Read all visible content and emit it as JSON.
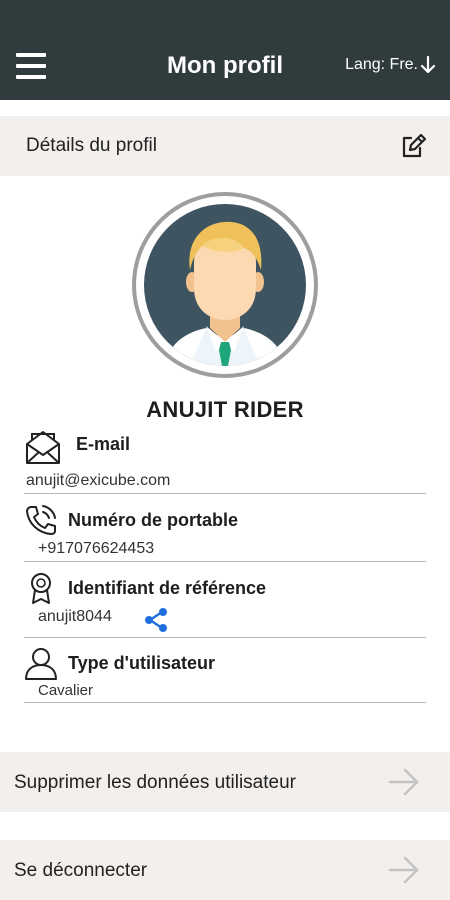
{
  "header": {
    "title": "Mon profil",
    "lang_label": "Lang: Fre.",
    "menu_icon": "hamburger-menu-icon",
    "lang_icon": "arrow-down-icon",
    "background": "#2f3b3d"
  },
  "profile_section": {
    "title": "Détails du profil",
    "edit_icon": "edit-icon"
  },
  "user": {
    "name": "ANUJIT RIDER",
    "avatar_icon": "user-avatar-icon"
  },
  "fields": {
    "email": {
      "label": "E-mail",
      "value": "anujit@exicube.com",
      "icon": "envelope-icon"
    },
    "mobile": {
      "label": "Numéro de portable",
      "value": "+917076624453",
      "icon": "phone-icon"
    },
    "referral": {
      "label": "Identifiant de référence",
      "value": "anujit8044",
      "icon": "ribbon-icon",
      "share_icon": "share-icon"
    },
    "usertype": {
      "label": "Type d'utilisateur",
      "value": "Cavalier",
      "icon": "user-outline-icon"
    }
  },
  "actions": {
    "delete_label": "Supprimer les données utilisateur",
    "logout_label": "Se déconnecter",
    "arrow_icon": "arrow-right-icon"
  },
  "colors": {
    "section_bg": "#f2efed",
    "share_blue": "#1e6ee0",
    "tie_green": "#1fa57a"
  }
}
